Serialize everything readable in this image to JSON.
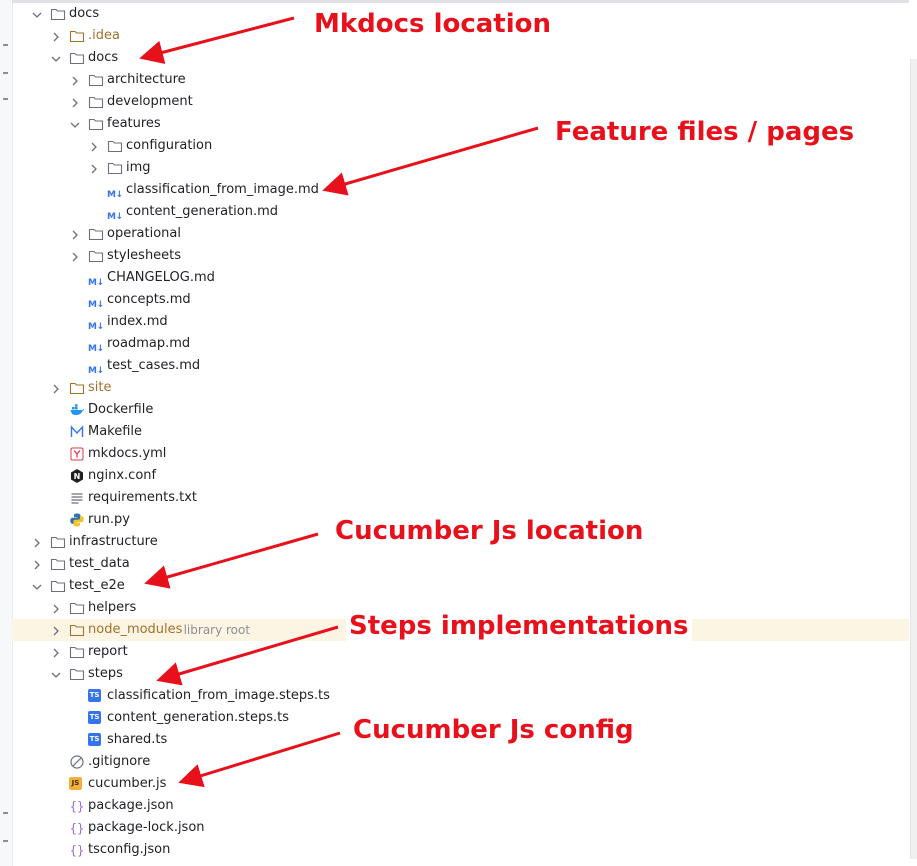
{
  "tree": {
    "rows": [
      {
        "label": "docs",
        "depth": 0,
        "kind": "folder",
        "expanded": true
      },
      {
        "label": ".idea",
        "depth": 1,
        "kind": "folder",
        "expanded": false,
        "color": "brown"
      },
      {
        "label": "docs",
        "depth": 1,
        "kind": "folder",
        "expanded": true
      },
      {
        "label": "architecture",
        "depth": 2,
        "kind": "folder",
        "expanded": false
      },
      {
        "label": "development",
        "depth": 2,
        "kind": "folder",
        "expanded": false
      },
      {
        "label": "features",
        "depth": 2,
        "kind": "folder",
        "expanded": true
      },
      {
        "label": "configuration",
        "depth": 3,
        "kind": "folder",
        "expanded": false
      },
      {
        "label": "img",
        "depth": 3,
        "kind": "folder",
        "expanded": false
      },
      {
        "label": "classification_from_image.md",
        "depth": 3,
        "kind": "md"
      },
      {
        "label": "content_generation.md",
        "depth": 3,
        "kind": "md"
      },
      {
        "label": "operational",
        "depth": 2,
        "kind": "folder",
        "expanded": false
      },
      {
        "label": "stylesheets",
        "depth": 2,
        "kind": "folder",
        "expanded": false
      },
      {
        "label": "CHANGELOG.md",
        "depth": 2,
        "kind": "md"
      },
      {
        "label": "concepts.md",
        "depth": 2,
        "kind": "md"
      },
      {
        "label": "index.md",
        "depth": 2,
        "kind": "md"
      },
      {
        "label": "roadmap.md",
        "depth": 2,
        "kind": "md"
      },
      {
        "label": "test_cases.md",
        "depth": 2,
        "kind": "md"
      },
      {
        "label": "site",
        "depth": 1,
        "kind": "folder",
        "expanded": false,
        "color": "brown"
      },
      {
        "label": "Dockerfile",
        "depth": 1,
        "kind": "docker"
      },
      {
        "label": "Makefile",
        "depth": 1,
        "kind": "makefile"
      },
      {
        "label": "mkdocs.yml",
        "depth": 1,
        "kind": "yaml"
      },
      {
        "label": "nginx.conf",
        "depth": 1,
        "kind": "nginx"
      },
      {
        "label": "requirements.txt",
        "depth": 1,
        "kind": "text"
      },
      {
        "label": "run.py",
        "depth": 1,
        "kind": "python"
      },
      {
        "label": "infrastructure",
        "depth": 0,
        "kind": "folder",
        "expanded": false
      },
      {
        "label": "test_data",
        "depth": 0,
        "kind": "folder",
        "expanded": false
      },
      {
        "label": "test_e2e",
        "depth": 0,
        "kind": "folder",
        "expanded": true
      },
      {
        "label": "helpers",
        "depth": 1,
        "kind": "folder",
        "expanded": false
      },
      {
        "label": "node_modules",
        "depth": 1,
        "kind": "folder",
        "expanded": false,
        "color": "brown",
        "note": "library root",
        "highlight": true
      },
      {
        "label": "report",
        "depth": 1,
        "kind": "folder",
        "expanded": false
      },
      {
        "label": "steps",
        "depth": 1,
        "kind": "folder",
        "expanded": true
      },
      {
        "label": "classification_from_image.steps.ts",
        "depth": 2,
        "kind": "ts"
      },
      {
        "label": "content_generation.steps.ts",
        "depth": 2,
        "kind": "ts"
      },
      {
        "label": "shared.ts",
        "depth": 2,
        "kind": "ts"
      },
      {
        "label": ".gitignore",
        "depth": 1,
        "kind": "ignore"
      },
      {
        "label": "cucumber.js",
        "depth": 1,
        "kind": "js"
      },
      {
        "label": "package.json",
        "depth": 1,
        "kind": "json"
      },
      {
        "label": "package-lock.json",
        "depth": 1,
        "kind": "json"
      },
      {
        "label": "tsconfig.json",
        "depth": 1,
        "kind": "json"
      }
    ]
  },
  "annotations": [
    {
      "id": "mkdocs-location",
      "text": "Mkdocs location"
    },
    {
      "id": "feature-files",
      "text": "Feature files / pages"
    },
    {
      "id": "cucumber-location",
      "text": "Cucumber Js location"
    },
    {
      "id": "steps-impl",
      "text": "Steps implementations"
    },
    {
      "id": "cucumber-config",
      "text": "Cucumber Js config"
    }
  ],
  "colors": {
    "annotation": "#e8101b",
    "md_icon": "#3574f0",
    "ts_icon": "#3574f0",
    "js_icon": "#f4af3d",
    "json_icon": "#9b6bd6",
    "excluded_folder": "#a0722d",
    "highlight_row": "#fdf5e4"
  },
  "icon_legend": {
    "md": "M↓",
    "ts": "TS",
    "js": "JS",
    "json": "{}",
    "nginx": "N"
  }
}
